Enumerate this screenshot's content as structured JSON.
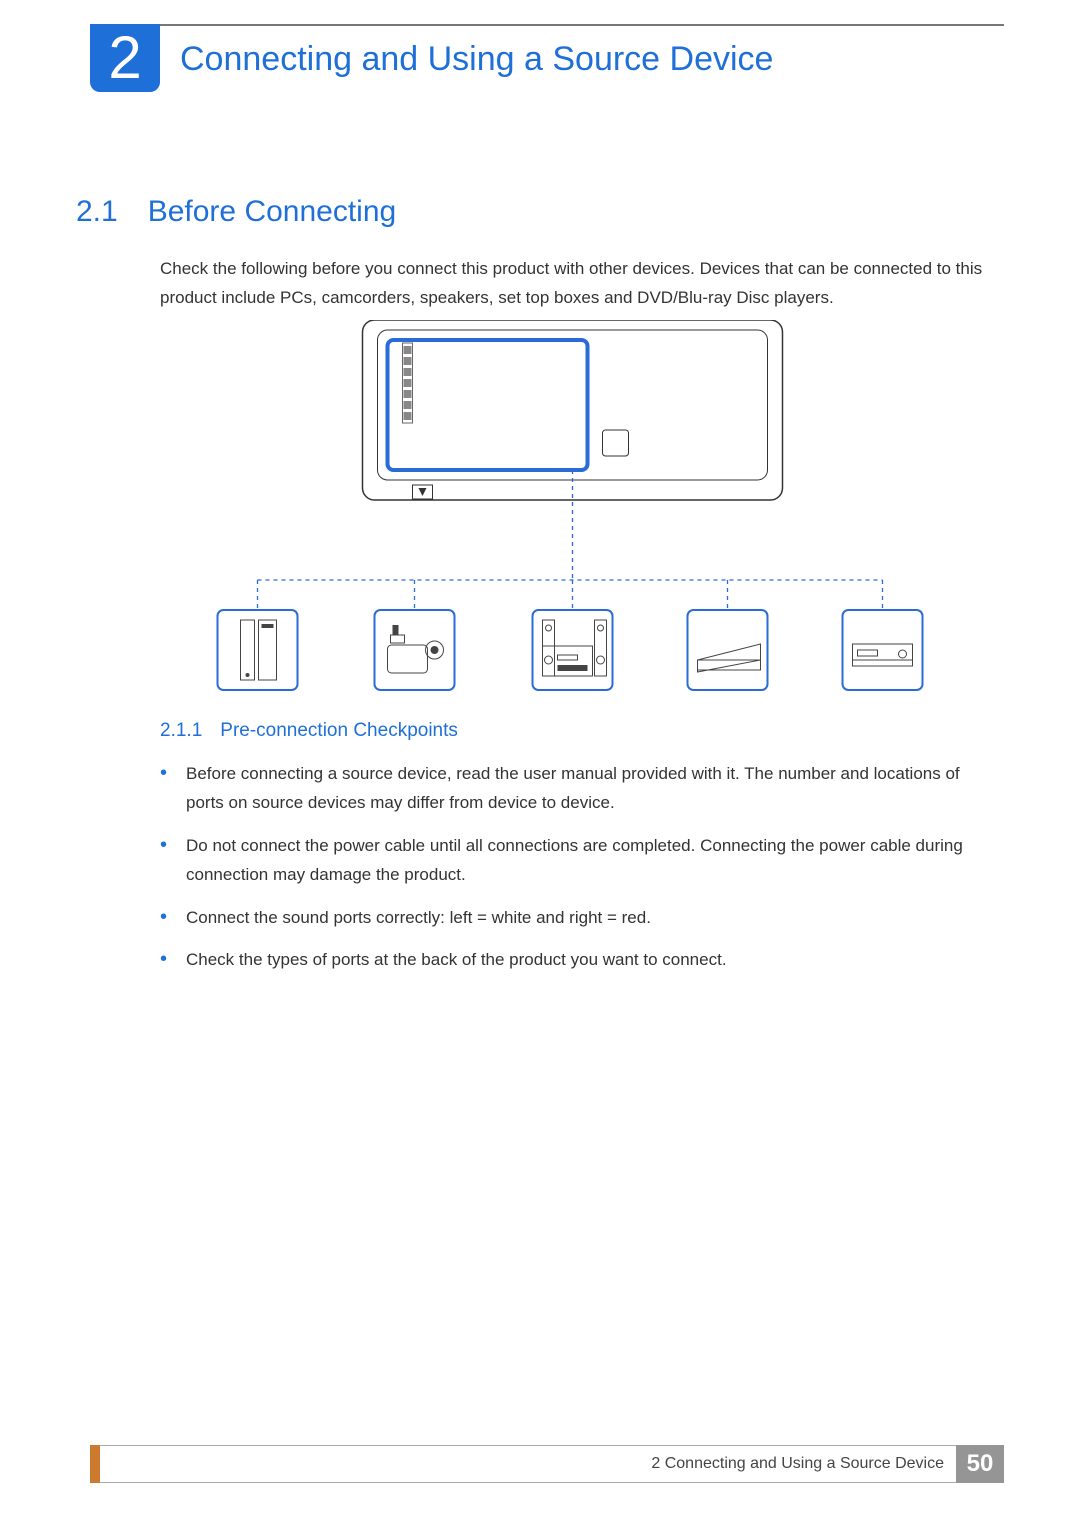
{
  "chapter": {
    "number": "2",
    "title": "Connecting and Using a Source Device"
  },
  "section": {
    "number": "2.1",
    "title": "Before Connecting",
    "paragraph": "Check the following before you connect this product with other devices. Devices that can be connected to this product include PCs, camcorders, speakers, set top boxes and DVD/Blu-ray Disc players."
  },
  "subsection": {
    "number": "2.1.1",
    "title": "Pre-connection Checkpoints"
  },
  "bullets": [
    "Before connecting a source device, read the user manual provided with it. The number and locations of ports on source devices may differ from device to device.",
    "Do not connect the power cable until all connections are completed. Connecting the power cable during connection may damage the product.",
    "Connect the sound ports correctly: left = white and right = red.",
    "Check the types of ports at the back of the product you want to connect."
  ],
  "footer": {
    "label": "2 Connecting and Using a Source Device",
    "page": "50"
  }
}
